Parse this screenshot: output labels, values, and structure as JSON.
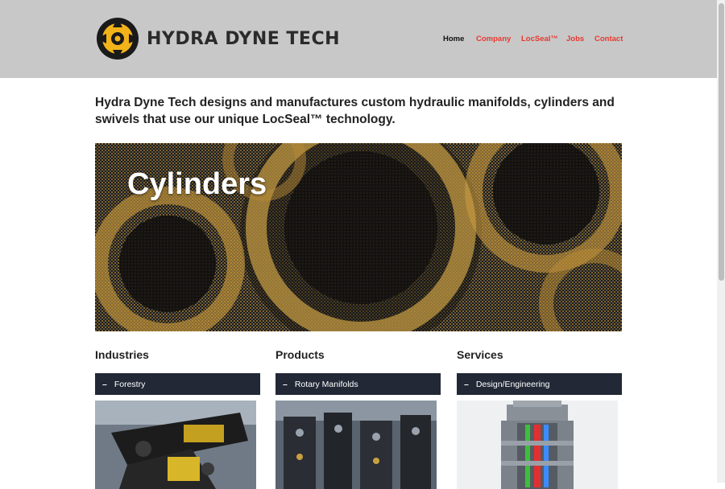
{
  "header": {
    "logo_text": "HYDRA DYNE TECH",
    "nav": [
      {
        "label": "Home",
        "active": true
      },
      {
        "label": "Company",
        "active": false
      },
      {
        "label": "LocSeal™",
        "active": false
      },
      {
        "label": "Jobs",
        "active": false
      },
      {
        "label": "Contact",
        "active": false
      }
    ]
  },
  "intro": "Hydra Dyne Tech designs and manufactures custom hydraulic manifolds, cylinders and swivels that use our unique LocSeal™ technology.",
  "hero": {
    "title": "Cylinders"
  },
  "columns": [
    {
      "heading": "Industries",
      "accordion": "Forestry",
      "image_icon": "machinery-photo"
    },
    {
      "heading": "Products",
      "accordion": "Rotary Manifolds",
      "image_icon": "factory-photo"
    },
    {
      "heading": "Services",
      "accordion": "Design/Engineering",
      "image_icon": "cad-render-photo"
    }
  ],
  "colors": {
    "header_bg": "#c8c8c8",
    "nav_link": "#e8382f",
    "accordion_bg": "#222836",
    "logo_yellow": "#f2b31a"
  }
}
